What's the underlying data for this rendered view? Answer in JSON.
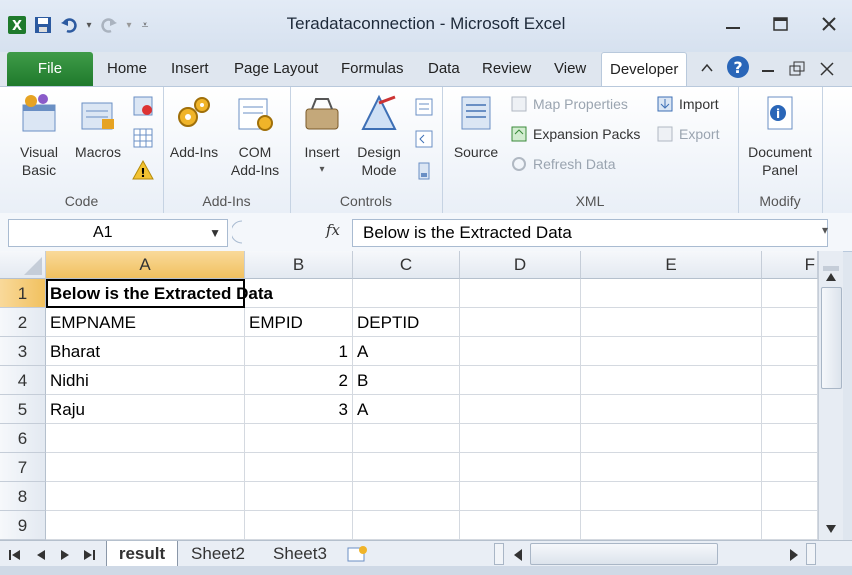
{
  "window": {
    "title": "Teradataconnection  -  Microsoft Excel",
    "controls": {
      "minimize": "minimize-icon",
      "restore": "restore-icon",
      "close": "close-icon"
    }
  },
  "qat": {
    "icons": [
      "excel-icon",
      "save-icon",
      "undo-icon",
      "redo-icon",
      "customize-icon"
    ]
  },
  "tabs": [
    {
      "label": "File"
    },
    {
      "label": "Home"
    },
    {
      "label": "Insert"
    },
    {
      "label": "Page Layout"
    },
    {
      "label": "Formulas"
    },
    {
      "label": "Data"
    },
    {
      "label": "Review"
    },
    {
      "label": "View"
    },
    {
      "label": "Developer"
    }
  ],
  "ribbon": {
    "code": {
      "label": "Code",
      "visual_basic": "Visual\nBasic",
      "macros": "Macros"
    },
    "addins": {
      "label": "Add-Ins",
      "addins_btn": "Add-Ins",
      "com": "COM\nAdd-Ins"
    },
    "controls": {
      "label": "Controls",
      "insert": "Insert",
      "design": "Design\nMode"
    },
    "xml": {
      "label": "XML",
      "source": "Source",
      "map_properties": "Map Properties",
      "expansion_packs": "Expansion Packs",
      "refresh_data": "Refresh Data",
      "import": "Import",
      "export": "Export"
    },
    "modify": {
      "label": "Modify",
      "document_panel": "Document\nPanel"
    }
  },
  "formula_bar": {
    "name_box": "A1",
    "fx": "fx",
    "content": "Below is the Extracted  Data"
  },
  "grid": {
    "columns": [
      "A",
      "B",
      "C",
      "D",
      "E",
      "F"
    ],
    "rows": [
      "1",
      "2",
      "3",
      "4",
      "5",
      "6",
      "7",
      "8",
      "9"
    ],
    "cells": {
      "A1": "Below is the Extracted  Data",
      "A2": "EMPNAME",
      "B2": "EMPID",
      "C2": "DEPTID",
      "A3": "Bharat",
      "B3": "1",
      "C3": "A",
      "A4": "Nidhi",
      "B4": "2",
      "C4": "B",
      "A5": "Raju",
      "B5": "3",
      "C5": "A"
    },
    "selected_cell": "A1"
  },
  "sheets": {
    "tabs": [
      "result",
      "Sheet2",
      "Sheet3"
    ],
    "active": "result"
  },
  "colors": {
    "file_tab": "#2a8a36",
    "selection_header": "#f4c86f"
  }
}
